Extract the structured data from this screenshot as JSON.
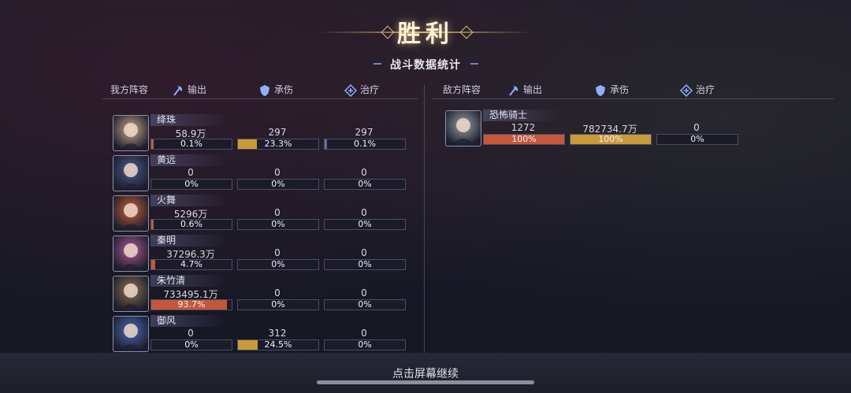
{
  "header": {
    "title": "胜利",
    "subtitle": "战斗数据统计"
  },
  "columns": {
    "ally_label": "我方阵容",
    "enemy_label": "敌方阵容",
    "output": "输出",
    "damage_taken": "承伤",
    "healing": "治疗"
  },
  "colors": {
    "output_fill": "#c4583c",
    "taken_fill": "#c99a38",
    "heal_fill": "#5a6fa8"
  },
  "allies": [
    {
      "name": "绛珠",
      "output": "58.9万",
      "output_pct": "0.1%",
      "output_ratio": 0.001,
      "taken": "297",
      "taken_pct": "23.3%",
      "taken_ratio": 0.233,
      "heal": "297",
      "heal_pct": "0.1%",
      "heal_ratio": 0.001,
      "avatar_color": "#c9a78a"
    },
    {
      "name": "黄远",
      "output": "0",
      "output_pct": "0%",
      "output_ratio": 0,
      "taken": "0",
      "taken_pct": "0%",
      "taken_ratio": 0,
      "heal": "0",
      "heal_pct": "0%",
      "heal_ratio": 0,
      "avatar_color": "#4a5a8a"
    },
    {
      "name": "火舞",
      "output": "5296万",
      "output_pct": "0.6%",
      "output_ratio": 0.006,
      "taken": "0",
      "taken_pct": "0%",
      "taken_ratio": 0,
      "heal": "0",
      "heal_pct": "0%",
      "heal_ratio": 0,
      "avatar_color": "#c8603a"
    },
    {
      "name": "秦明",
      "output": "37296.3万",
      "output_pct": "4.7%",
      "output_ratio": 0.047,
      "taken": "0",
      "taken_pct": "0%",
      "taken_ratio": 0,
      "heal": "0",
      "heal_pct": "0%",
      "heal_ratio": 0,
      "avatar_color": "#b05a9a"
    },
    {
      "name": "朱竹清",
      "output": "733495.1万",
      "output_pct": "93.7%",
      "output_ratio": 0.937,
      "taken": "0",
      "taken_pct": "0%",
      "taken_ratio": 0,
      "heal": "0",
      "heal_pct": "0%",
      "heal_ratio": 0,
      "avatar_color": "#8a7050"
    },
    {
      "name": "御风",
      "output": "0",
      "output_pct": "0%",
      "output_ratio": 0,
      "taken": "312",
      "taken_pct": "24.5%",
      "taken_ratio": 0.245,
      "heal": "0",
      "heal_pct": "0%",
      "heal_ratio": 0,
      "avatar_color": "#4a6ab8"
    }
  ],
  "enemies": [
    {
      "name": "恐怖骑士",
      "output": "1272",
      "output_pct": "100%",
      "output_ratio": 1.0,
      "taken": "782734.7万",
      "taken_pct": "100%",
      "taken_ratio": 1.0,
      "heal": "0",
      "heal_pct": "0%",
      "heal_ratio": 0,
      "avatar_color": "#9aa0aa"
    }
  ],
  "footer": {
    "continue_text": "点击屏幕继续"
  }
}
